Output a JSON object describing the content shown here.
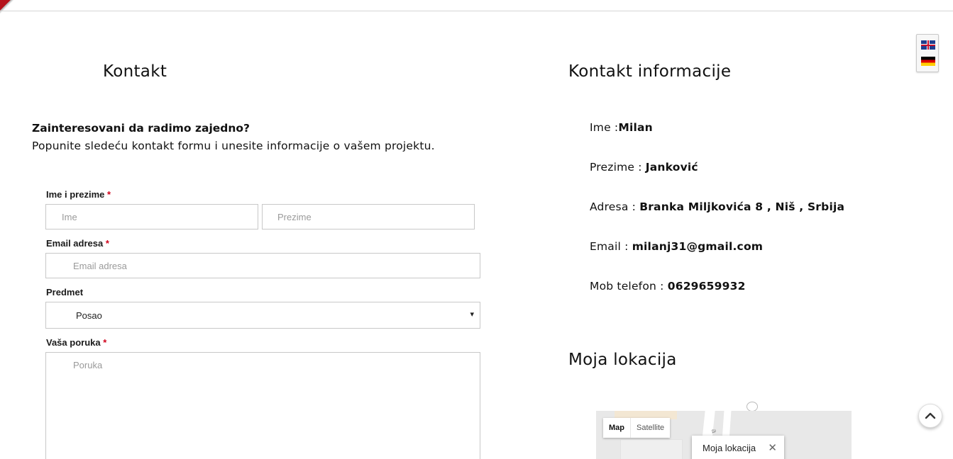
{
  "form_section": {
    "title": "Kontakt",
    "question": "Zainteresovani da radimo zajedno?",
    "intro": "Popunite sledeću kontakt formu i unesite informacije o vašem projektu.",
    "name_label": "Ime i prezime",
    "required_mark": "*",
    "first_name_placeholder": "Ime",
    "last_name_placeholder": "Prezime",
    "email_label": "Email adresa",
    "email_placeholder": "Email adresa",
    "subject_label": "Predmet",
    "subject_selected": "Posao",
    "message_label": "Vaša poruka",
    "message_placeholder": "Poruka"
  },
  "info_section": {
    "title": "Kontakt informacije",
    "rows": [
      {
        "label": "Ime :",
        "value": "Milan"
      },
      {
        "label": "Prezime : ",
        "value": "Janković"
      },
      {
        "label": "Adresa : ",
        "value": "Branka Miljkovića 8 , Niš , Srbija"
      },
      {
        "label": "Email : ",
        "value": "milanj31@gmail.com"
      },
      {
        "label": "Mob telefon : ",
        "value": "0629659932"
      }
    ]
  },
  "location_section": {
    "title": "Moja lokacija",
    "map_type_map": "Map",
    "map_type_satellite": "Satellite",
    "info_window_text": "Moja lokacija",
    "info_window_close": "✕",
    "road_label": "a"
  },
  "language_switcher": {
    "languages": [
      "English",
      "Deutsch"
    ]
  },
  "icons": {
    "scroll_top": "chevron-up-icon",
    "select_arrow": "▾"
  },
  "colors": {
    "accent": "#b5121b",
    "required": "#d0021b"
  }
}
